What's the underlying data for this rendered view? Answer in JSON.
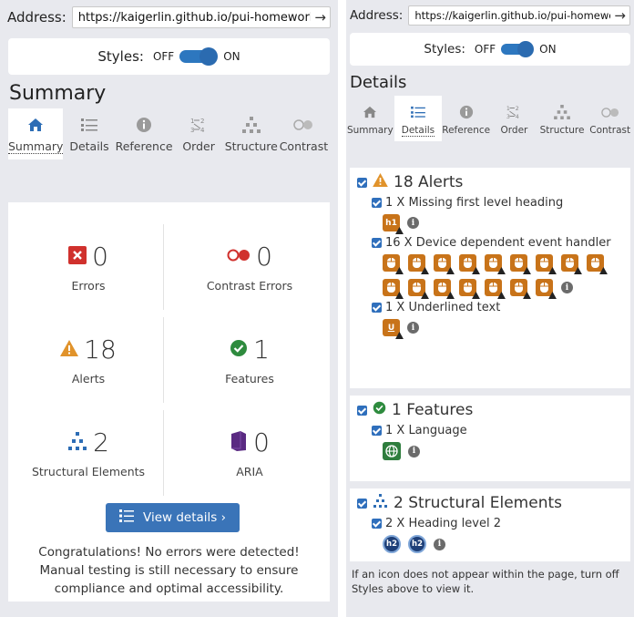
{
  "address": {
    "label": "Address:",
    "url": "https://kaigerlin.github.io/pui-homework-ter",
    "go_icon": "arrow-right-icon"
  },
  "styles": {
    "label": "Styles:",
    "off": "OFF",
    "on": "ON"
  },
  "tabs": [
    {
      "label": "Summary",
      "icon": "home-icon"
    },
    {
      "label": "Details",
      "icon": "list-icon"
    },
    {
      "label": "Reference",
      "icon": "info-icon"
    },
    {
      "label": "Order",
      "icon": "order-icon"
    },
    {
      "label": "Structure",
      "icon": "hierarchy-icon"
    },
    {
      "label": "Contrast",
      "icon": "contrast-icon"
    }
  ],
  "summary": {
    "title": "Summary",
    "stats": [
      {
        "count": "0",
        "label": "Errors",
        "icon": "error-icon",
        "color": "#d0312d"
      },
      {
        "count": "0",
        "label": "Contrast Errors",
        "icon": "contrast-error-icon",
        "color": "#d0312d"
      },
      {
        "count": "18",
        "label": "Alerts",
        "icon": "alert-icon",
        "color": "#e1932b"
      },
      {
        "count": "1",
        "label": "Features",
        "icon": "feature-icon",
        "color": "#2e8b3e"
      },
      {
        "count": "2",
        "label": "Structural Elements",
        "icon": "structure-icon",
        "color": "#2d6db5"
      },
      {
        "count": "0",
        "label": "ARIA",
        "icon": "aria-icon",
        "color": "#5a2a82"
      }
    ],
    "view_details": "View details ›",
    "message": "Congratulations! No errors were detected! Manual testing is still necessary to ensure compliance and optimal accessibility."
  },
  "details": {
    "title": "Details",
    "groups": [
      {
        "title": "18 Alerts",
        "items": [
          {
            "text": "1 X Missing first level heading",
            "icon_label": "h1"
          },
          {
            "text": "16 X Device dependent event handler"
          },
          {
            "text": "1 X Underlined text",
            "icon_label": "U"
          }
        ]
      },
      {
        "title": "1 Features",
        "items": [
          {
            "text": "1 X Language"
          }
        ]
      },
      {
        "title": "2 Structural Elements",
        "items": [
          {
            "text": "2 X Heading level 2",
            "icon_label": "h2"
          }
        ]
      }
    ],
    "footnote": "If an icon does not appear within the page, turn off Styles above to view it."
  }
}
